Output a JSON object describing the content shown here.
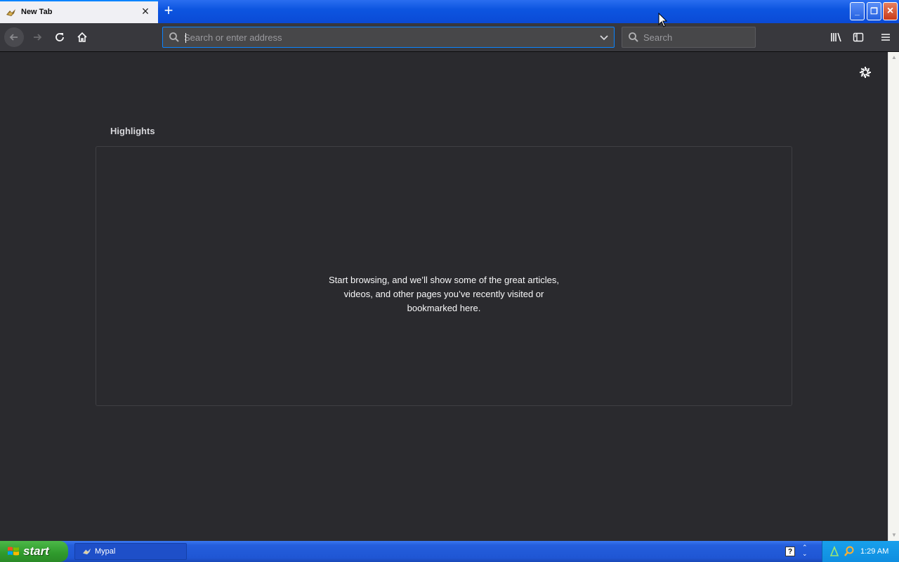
{
  "tab": {
    "title": "New Tab",
    "close_glyph": "×",
    "new_tab_glyph": "+"
  },
  "window_controls": {
    "minimize": "_",
    "maximize": "❐",
    "close": "×"
  },
  "navbar": {
    "url_placeholder": "Search or enter address",
    "url_value": "",
    "search_placeholder": "Search"
  },
  "content": {
    "highlights_title": "Highlights",
    "empty_message": "Start browsing, and we’ll show some of the great articles, videos, and other pages you’ve recently visited or bookmarked here."
  },
  "taskbar": {
    "start_label": "start",
    "task_label": "Mypal",
    "help_glyph": "?",
    "clock": "1:29 AM"
  },
  "colors": {
    "accent": "#0a84ff",
    "toolbar": "#38383d",
    "content_bg": "#2a2a2e",
    "titlebar_blue": "#0d55e0",
    "taskbar_blue": "#245edc",
    "start_green": "#2f9a2c"
  }
}
